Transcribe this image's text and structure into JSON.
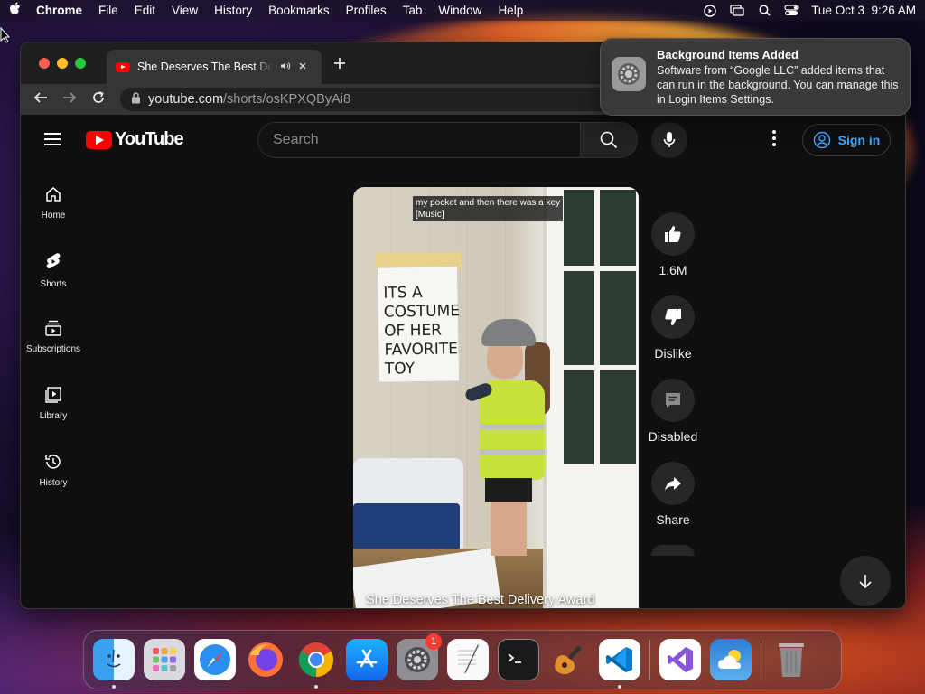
{
  "menubar": {
    "app_name": "Chrome",
    "items": [
      "File",
      "Edit",
      "View",
      "History",
      "Bookmarks",
      "Profiles",
      "Tab",
      "Window",
      "Help"
    ],
    "clock": "Tue Oct 3  9:26 AM",
    "status_icons": [
      "play-circle-icon",
      "screen-mirror-icon",
      "search-icon",
      "control-center-icon"
    ]
  },
  "browser": {
    "tab_title": "She Deserves The Best Delivery Award",
    "url_host": "youtube.com",
    "url_path": "/shorts/osKPXQByAi8"
  },
  "youtube": {
    "logo_text": "YouTube",
    "search_placeholder": "Search",
    "sign_in": "Sign in",
    "sidebar": [
      {
        "label": "Home",
        "icon": "home-icon"
      },
      {
        "label": "Shorts",
        "icon": "shorts-icon"
      },
      {
        "label": "Subscriptions",
        "icon": "subscriptions-icon"
      },
      {
        "label": "Library",
        "icon": "library-icon"
      },
      {
        "label": "History",
        "icon": "history-icon"
      }
    ],
    "short": {
      "caption_line1": "my pocket and then there was a key",
      "caption_line2": "[Music]",
      "sign_text": "ITS A COSTUME OF HER FAVORITE TOY",
      "title": "She Deserves The Best Delivery Award"
    },
    "actions": {
      "likes": "1.6M",
      "dislike": "Dislike",
      "comments": "Disabled",
      "share": "Share"
    }
  },
  "notification": {
    "title": "Background Items Added",
    "body": "Software from “Google LLC” added items that can run in the background. You can manage this in Login Items Settings."
  },
  "dock": {
    "apps": [
      "Finder",
      "Launchpad",
      "Safari",
      "Firefox",
      "Chrome",
      "App Store",
      "System Settings",
      "TextEdit",
      "Terminal",
      "GarageBand",
      "Visual Studio Code",
      "Visual Studio",
      "Weather",
      "Trash"
    ],
    "settings_badge": "1"
  },
  "colors": {
    "youtube_red": "#ff0000",
    "link_blue": "#3ea6ff",
    "page_bg": "#0f0f0f"
  }
}
